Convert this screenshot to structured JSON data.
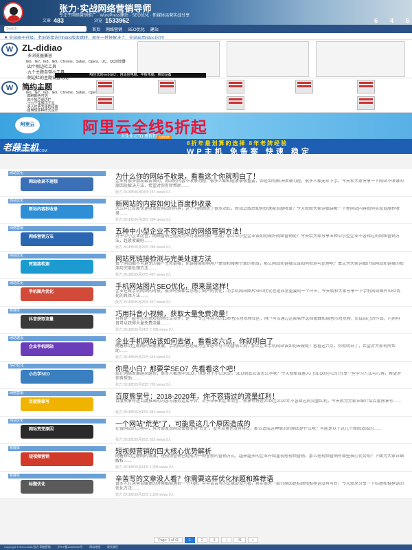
{
  "header": {
    "title": "张力·实战网络营销导师",
    "desc": "专注于网络营销推广 · WordPress建站 · SEO优化 · 新媒体运营实战分享",
    "stats": [
      {
        "label": "文章",
        "value": "483"
      },
      {
        "label": "浏览",
        "value": "1533962"
      }
    ],
    "stats_right": [
      "6",
      "4",
      "6"
    ]
  },
  "nav": {
    "search_placeholder": "Search",
    "items": [
      "首页",
      "网络营销",
      "SEO优化",
      "建站"
    ]
  },
  "notice": "⚑ 全站由于升级，老旧链接访问https版本跳转，现在一并将解决了，全站启用https访问！",
  "promo": {
    "name1": "ZL-didiao",
    "list1": [
      "·多浏览器兼容",
      "IE6、IE7、IE8、IE9、Chrome、Safari、Opera、UC、QQ浏览器",
      "·四个侧边栏工具",
      "·九个主题自带小工具",
      "·侧边栏的主题设置功能"
    ],
    "bar1": "响应式的web设计，自适应电脑、平板电脑、移动设备",
    "name2": "简约主题",
    "list2": [
      "·多浏览器兼容",
      "IE6、IE7、IE8、IE9、Chrome、Safari、Opera",
      "·四种颜色可选",
      "·四个独立侧边栏",
      "·十九个主题小工具",
      "·更人性更方便的设置",
      "·自带较多种样式设计"
    ],
    "ad_title": "阿里云全线5折起",
    "ad_sub": "大企业·CTO 高折扣",
    "ad_btn": "立即抢购",
    "ad_brand": "阿里云",
    "strip_logo": "老薛主机",
    "strip_url": "LAOXUEHOST.COM",
    "strip_r1": "8折年最划算的选择 8年老牌经验",
    "strip_r2": "WP主机 免备案 快速 稳定"
  },
  "posts": [
    {
      "title": "为什么你的网站不收录，看看这个你就明白了！",
      "excerpt": "企业有很多朋友最苦恼的，网站的内容不收录问题，很多人都知道收录很重要，但是如何解决收录问题，很多人都无从下手。今天和大家分享一下网站不收录的原因及解决方法，希望对你有所帮助……",
      "meta": "张力  2018年06月03日  157 views  0人",
      "cat": "网站优化",
      "caption": "网站收录不理想"
    },
    {
      "title": "新网站的内容如何让百度秒收录",
      "excerpt": "怎么样让百度快速收录新网站的内容，这个问题困扰了很多站长，新站上线后如何快速被百度收录？今天就给大家详细讲解一下新网站内容如何实现百度秒收录……",
      "meta": "张力  2018年06月02日  284 views  0人",
      "cat": "网站优化",
      "caption": "新站内容秒收录"
    },
    {
      "title": "五种中小型企业不容错过的网络营销方法！",
      "excerpt": "对于中小企业而言，网络营销已经成为不可或缺的推广手段，那么中小型企业该如何做好网络营销呢？今天给大家分享五种中小型企业不容错过的网络营销方法，赶紧收藏吧……",
      "meta": "张力  2018年05月29日  289 views  0人",
      "cat": "网络营销",
      "caption": "网络营销方法"
    },
    {
      "title": "网站死链接检测与完美处理方法",
      "excerpt": "每个网站都不可避免的会产生死链接，死链接会影响用户体验和搜索引擎的抓取，那么网站死链接应该如何检测与处理呢？本文为大家详细介绍网站死链接的检测与完美处理方法……",
      "meta": "张力  2018年05月27日  497 views  0人",
      "cat": "网站优化",
      "caption": "死链接检测"
    },
    {
      "title": "手机网站图片SEO优化，原来是这样！",
      "excerpt": "企业在做手机网站的时候，很多时候都会忽略了图片的优化，而手机网站图片SEO优化也是非常重要的一个环节，今天就和大家分享一下手机网站图片SEO优化的具体方法……",
      "meta": "张力  2018年05月26日  467 views  0人",
      "cat": "网站优化",
      "caption": "手机图片优化"
    },
    {
      "title": "巧用抖音小视频，获取大量免费流量！",
      "excerpt": "抖音是一款音乐创意短视频社交软件，是一个专注年轻人的15秒音乐短视频社区，用户可以通过这款软件选择歌曲拍摄音乐短视频，形成自己的作品，巧用抖音可以获得大量免费流量……",
      "meta": "张力  2018年05月24日  2,788 views  0人",
      "cat": "新媒体",
      "caption": "抖音获取流量"
    },
    {
      "title": "企业手机网站该如何去做，看看这六点，你就明白了",
      "excerpt": "随着移动互联网的快速发展，手机网站已经成为企业必不可少的营销工具，那么企业手机网站该如何去做呢？看看这六点，你就明白了，希望对大家有所帮助……",
      "meta": "张力  2018年05月22日  548 views  0人",
      "cat": "网站建设",
      "caption": "企业手机网站"
    },
    {
      "title": "你是小白？那要学SEO？先看看这个吧！",
      "excerpt": "现在网络发展越来越快，很多人都想学SEO，但是对于小白来说，SEO到底应该怎么学呢？今天就给准备入门SEO的小白们分享一些学习方法与心得，希望对你有帮助……",
      "meta": "张力  2018年05月20日  750 views  0人",
      "cat": "SEO优化",
      "caption": "小白学SEO"
    },
    {
      "title": "百度熊掌号：2018-2020年，你不容错过的流量红利！",
      "excerpt": "百度熊掌号是百度推出的内容与服务连接平台，对于站长和企业而言，熊掌号将是2018至2020年不容错过的流量红利，今天就为大家详细介绍百度熊掌号……",
      "meta": "张力  2018年05月18日  881 views  0人",
      "cat": "网络营销",
      "caption": "百度熊掌号"
    },
    {
      "title": "一个网站“荒芜”了，可能是这几个原因造成的",
      "excerpt": "在做网站的过程中，有时会发现网站慢慢变得“荒芜”，没有流量也没有排名，那么造成这种情况的原因是什么呢？可能是以下这几个原因造成的……",
      "meta": "张力  2018年05月16日  522 views  0人",
      "cat": "网站优化",
      "caption": "网站荒芜原因"
    },
    {
      "title": "短视频营销的四大核心优势解析",
      "excerpt": "随着移动互联网的发展，短视频营销已经成为一种全新的营销方式，越来越多的企业开始重视短视频营销，那么短视频营销有哪些核心优势呢？下面为大家详细解析……",
      "meta": "张力  2018年05月14日  1,308 views  0人",
      "cat": "新媒体",
      "caption": "短视频营销"
    },
    {
      "title": "辛苦写的文章没人看？你需要这样优化标题和推荐语",
      "excerpt": "很多人在运营自媒体的时候都会遇到一个问题，辛辛苦苦写的文章却没人看，其实很大一部分原因是标题和推荐语没有写好，今天就来分享一下标题和推荐语的优化方法……",
      "meta": "张力  2018年05月12日  1,266 views  0人",
      "cat": "新媒体",
      "caption": "标题优化"
    }
  ],
  "pager": [
    "Page: 1 of 41",
    "1",
    "2",
    "3",
    "»",
    "41",
    "»"
  ],
  "footer": [
    "Copyright © 2014-2018 张力 网络营销",
    "沪ICP备14020012号",
    "网站地图",
    "联系我们"
  ],
  "colors": {
    "header": "#2a5286",
    "accent": "#2b7ad8"
  }
}
